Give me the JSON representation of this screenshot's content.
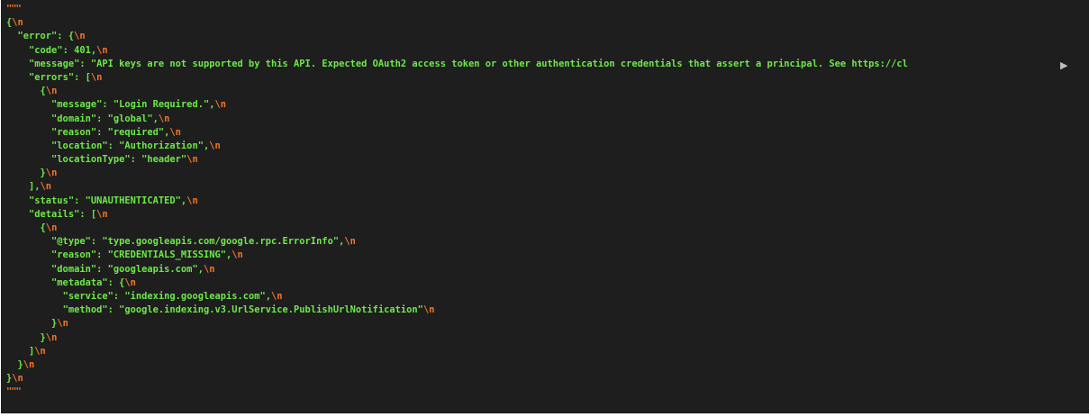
{
  "terminal": {
    "expand_arrow": "▶",
    "lines": [
      {
        "indent": "",
        "text": "\"\"\"",
        "nl": "",
        "kind": "quote"
      },
      {
        "indent": "",
        "text": "{",
        "nl": "\\n"
      },
      {
        "indent": "  ",
        "text": "\"error\": {",
        "nl": "\\n"
      },
      {
        "indent": "    ",
        "text": "\"code\": 401,",
        "nl": "\\n"
      },
      {
        "indent": "    ",
        "text": "\"message\": \"API keys are not supported by this API. Expected OAuth2 access token or other authentication credentials that assert a principal. See https://cl",
        "nl": ""
      },
      {
        "indent": "    ",
        "text": "\"errors\": [",
        "nl": "\\n"
      },
      {
        "indent": "      ",
        "text": "{",
        "nl": "\\n"
      },
      {
        "indent": "        ",
        "text": "\"message\": \"Login Required.\",",
        "nl": "\\n"
      },
      {
        "indent": "        ",
        "text": "\"domain\": \"global\",",
        "nl": "\\n"
      },
      {
        "indent": "        ",
        "text": "\"reason\": \"required\",",
        "nl": "\\n"
      },
      {
        "indent": "        ",
        "text": "\"location\": \"Authorization\",",
        "nl": "\\n"
      },
      {
        "indent": "        ",
        "text": "\"locationType\": \"header\"",
        "nl": "\\n"
      },
      {
        "indent": "      ",
        "text": "}",
        "nl": "\\n"
      },
      {
        "indent": "    ",
        "text": "],",
        "nl": "\\n"
      },
      {
        "indent": "    ",
        "text": "\"status\": \"UNAUTHENTICATED\",",
        "nl": "\\n"
      },
      {
        "indent": "    ",
        "text": "\"details\": [",
        "nl": "\\n"
      },
      {
        "indent": "      ",
        "text": "{",
        "nl": "\\n"
      },
      {
        "indent": "        ",
        "text": "\"@type\": \"type.googleapis.com/google.rpc.ErrorInfo\",",
        "nl": "\\n"
      },
      {
        "indent": "        ",
        "text": "\"reason\": \"CREDENTIALS_MISSING\",",
        "nl": "\\n"
      },
      {
        "indent": "        ",
        "text": "\"domain\": \"googleapis.com\",",
        "nl": "\\n"
      },
      {
        "indent": "        ",
        "text": "\"metadata\": {",
        "nl": "\\n"
      },
      {
        "indent": "          ",
        "text": "\"service\": \"indexing.googleapis.com\",",
        "nl": "\\n"
      },
      {
        "indent": "          ",
        "text": "\"method\": \"google.indexing.v3.UrlService.PublishUrlNotification\"",
        "nl": "\\n"
      },
      {
        "indent": "        ",
        "text": "}",
        "nl": "\\n"
      },
      {
        "indent": "      ",
        "text": "}",
        "nl": "\\n"
      },
      {
        "indent": "    ",
        "text": "]",
        "nl": "\\n"
      },
      {
        "indent": "  ",
        "text": "}",
        "nl": "\\n"
      },
      {
        "indent": "",
        "text": "}",
        "nl": "\\n"
      },
      {
        "indent": "",
        "text": "\"\"\"",
        "nl": "",
        "kind": "quote"
      }
    ]
  }
}
